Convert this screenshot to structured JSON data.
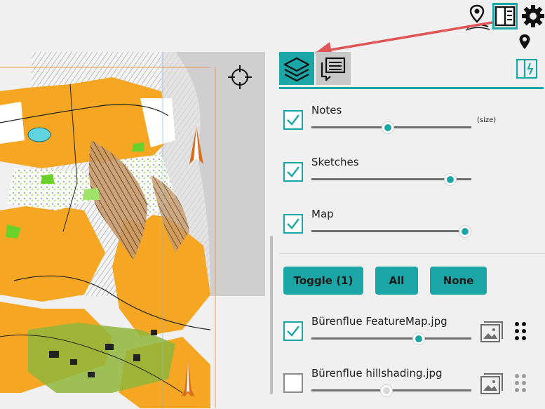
{
  "toolbar": {
    "pin_route_icon": "pin-route-icon",
    "panel_toggle_icon": "side-panel-icon",
    "settings_icon": "gear-icon",
    "pin_icon": "map-pin-icon"
  },
  "tabs": [
    {
      "name": "layers",
      "icon": "layers-icon",
      "active": true
    },
    {
      "name": "notes",
      "icon": "chat-icon",
      "active": false
    }
  ],
  "layers": [
    {
      "label": "Notes",
      "checked": true,
      "opacity": 0.48,
      "size_label": "(size)"
    },
    {
      "label": "Sketches",
      "checked": true,
      "opacity": 0.87
    },
    {
      "label": "Map",
      "checked": true,
      "opacity": 0.96
    }
  ],
  "buttons": {
    "toggle": "Toggle (1)",
    "all": "All",
    "none": "None"
  },
  "images": [
    {
      "label": "Bürenflue FeatureMap.jpg",
      "checked": true,
      "opacity": 0.67
    },
    {
      "label": "Bürenflue hillshading.jpg",
      "checked": false,
      "opacity": 0.47
    }
  ],
  "colors": {
    "accent": "#1aa6a6",
    "arrow": "#e05555",
    "map_orange": "#f5a623",
    "map_green": "#6ad12a"
  }
}
